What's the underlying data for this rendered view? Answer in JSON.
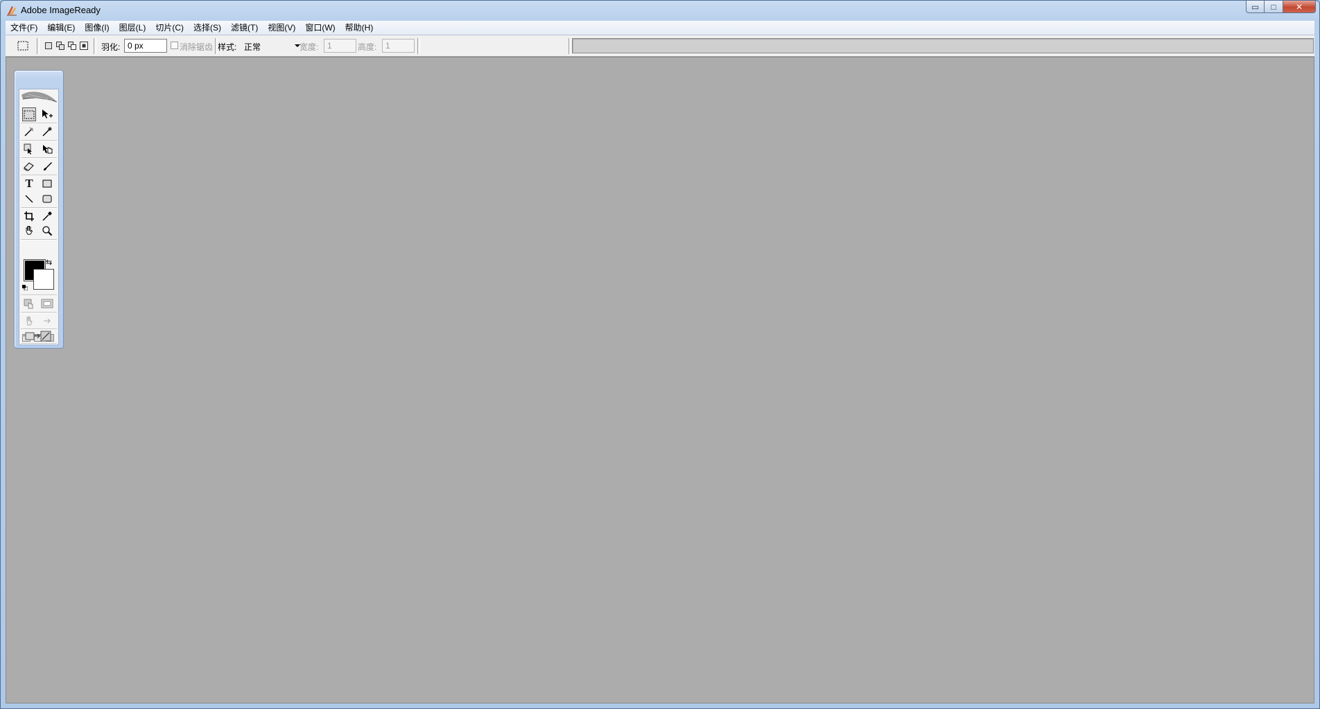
{
  "window": {
    "title": "Adobe ImageReady",
    "controls": {
      "minimize": "▭",
      "maximize": "□",
      "close": "✕"
    }
  },
  "menubar": {
    "items": [
      {
        "label": "文件(F)"
      },
      {
        "label": "编辑(E)"
      },
      {
        "label": "图像(I)"
      },
      {
        "label": "图层(L)"
      },
      {
        "label": "切片(C)"
      },
      {
        "label": "选择(S)"
      },
      {
        "label": "滤镜(T)"
      },
      {
        "label": "视图(V)"
      },
      {
        "label": "窗口(W)"
      },
      {
        "label": "帮助(H)"
      }
    ]
  },
  "options": {
    "feather_label": "羽化:",
    "feather_value": "0 px",
    "antialias_label": "消除锯齿",
    "antialias_checked": false,
    "style_label": "样式:",
    "style_value": "正常",
    "width_label": "宽度:",
    "width_value": "1",
    "height_label": "高度:",
    "height_value": "1"
  },
  "toolbox": {
    "text_tool_glyph": "T",
    "swap_glyph": "⇆",
    "foreground_color": "#000000",
    "background_color": "#ffffff"
  },
  "colors": {
    "workspace": "#acacac",
    "titlebar": "#b8d0ec",
    "menubar": "#eef2f8"
  }
}
